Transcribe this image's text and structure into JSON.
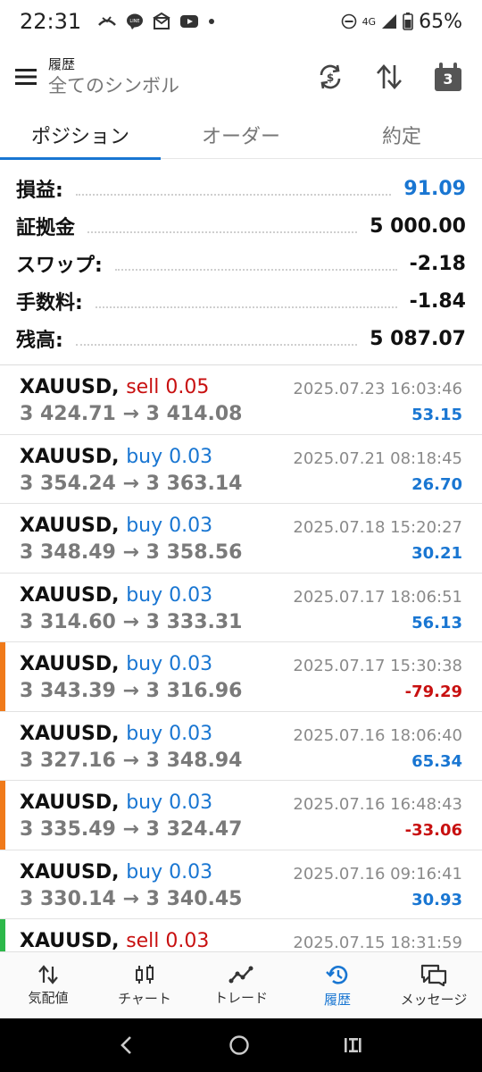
{
  "status_bar": {
    "time": "22:31",
    "network": "4G",
    "battery": "65%",
    "notification_icons": [
      "missed-call-icon",
      "line-icon",
      "mail-icon",
      "youtube-icon",
      "dot-icon"
    ]
  },
  "header": {
    "title": "履歴",
    "subtitle": "全てのシンボル",
    "calendar_badge": "3"
  },
  "tabs": [
    {
      "label": "ポジション",
      "active": true
    },
    {
      "label": "オーダー",
      "active": false
    },
    {
      "label": "約定",
      "active": false
    }
  ],
  "summary": [
    {
      "label": "損益:",
      "value": "91.09",
      "color": "#1976d2"
    },
    {
      "label": "証拠金",
      "value": "5 000.00",
      "color": "#111111"
    },
    {
      "label": "スワップ:",
      "value": "-2.18",
      "color": "#111111"
    },
    {
      "label": "手数料:",
      "value": "-1.84",
      "color": "#111111"
    },
    {
      "label": "残高:",
      "value": "5 087.07",
      "color": "#111111"
    }
  ],
  "trades": [
    {
      "symbol": "XAUUSD,",
      "side": "sell 0.05",
      "type": "sell",
      "date": "2025.07.23 16:03:46",
      "prices": "3 424.71 → 3 414.08",
      "profit": "53.15",
      "positive": true,
      "marker": ""
    },
    {
      "symbol": "XAUUSD,",
      "side": "buy 0.03",
      "type": "buy",
      "date": "2025.07.21 08:18:45",
      "prices": "3 354.24 → 3 363.14",
      "profit": "26.70",
      "positive": true,
      "marker": ""
    },
    {
      "symbol": "XAUUSD,",
      "side": "buy 0.03",
      "type": "buy",
      "date": "2025.07.18 15:20:27",
      "prices": "3 348.49 → 3 358.56",
      "profit": "30.21",
      "positive": true,
      "marker": ""
    },
    {
      "symbol": "XAUUSD,",
      "side": "buy 0.03",
      "type": "buy",
      "date": "2025.07.17 18:06:51",
      "prices": "3 314.60 → 3 333.31",
      "profit": "56.13",
      "positive": true,
      "marker": ""
    },
    {
      "symbol": "XAUUSD,",
      "side": "buy 0.03",
      "type": "buy",
      "date": "2025.07.17 15:30:38",
      "prices": "3 343.39 → 3 316.96",
      "profit": "-79.29",
      "positive": false,
      "marker": "#f07a1a"
    },
    {
      "symbol": "XAUUSD,",
      "side": "buy 0.03",
      "type": "buy",
      "date": "2025.07.16 18:06:40",
      "prices": "3 327.16 → 3 348.94",
      "profit": "65.34",
      "positive": true,
      "marker": ""
    },
    {
      "symbol": "XAUUSD,",
      "side": "buy 0.03",
      "type": "buy",
      "date": "2025.07.16 16:48:43",
      "prices": "3 335.49 → 3 324.47",
      "profit": "-33.06",
      "positive": false,
      "marker": "#f07a1a"
    },
    {
      "symbol": "XAUUSD,",
      "side": "buy 0.03",
      "type": "buy",
      "date": "2025.07.16 09:16:41",
      "prices": "3 330.14 → 3 340.45",
      "profit": "30.93",
      "positive": true,
      "marker": ""
    },
    {
      "symbol": "XAUUSD,",
      "side": "sell 0.03",
      "type": "sell",
      "date": "2025.07.15 18:31:59",
      "prices": "",
      "profit": "",
      "positive": true,
      "marker": "#2db84a"
    }
  ],
  "bottom_nav": [
    {
      "label": "気配値",
      "icon": "quotes-icon",
      "active": false
    },
    {
      "label": "チャート",
      "icon": "chart-icon",
      "active": false
    },
    {
      "label": "トレード",
      "icon": "trade-icon",
      "active": false
    },
    {
      "label": "履歴",
      "icon": "history-icon",
      "active": true
    },
    {
      "label": "メッセージ",
      "icon": "messages-icon",
      "active": false
    }
  ],
  "colors": {
    "accent": "#1976d2",
    "loss": "#c81010",
    "loss_marker": "#f07a1a",
    "sell_marker": "#2db84a"
  }
}
